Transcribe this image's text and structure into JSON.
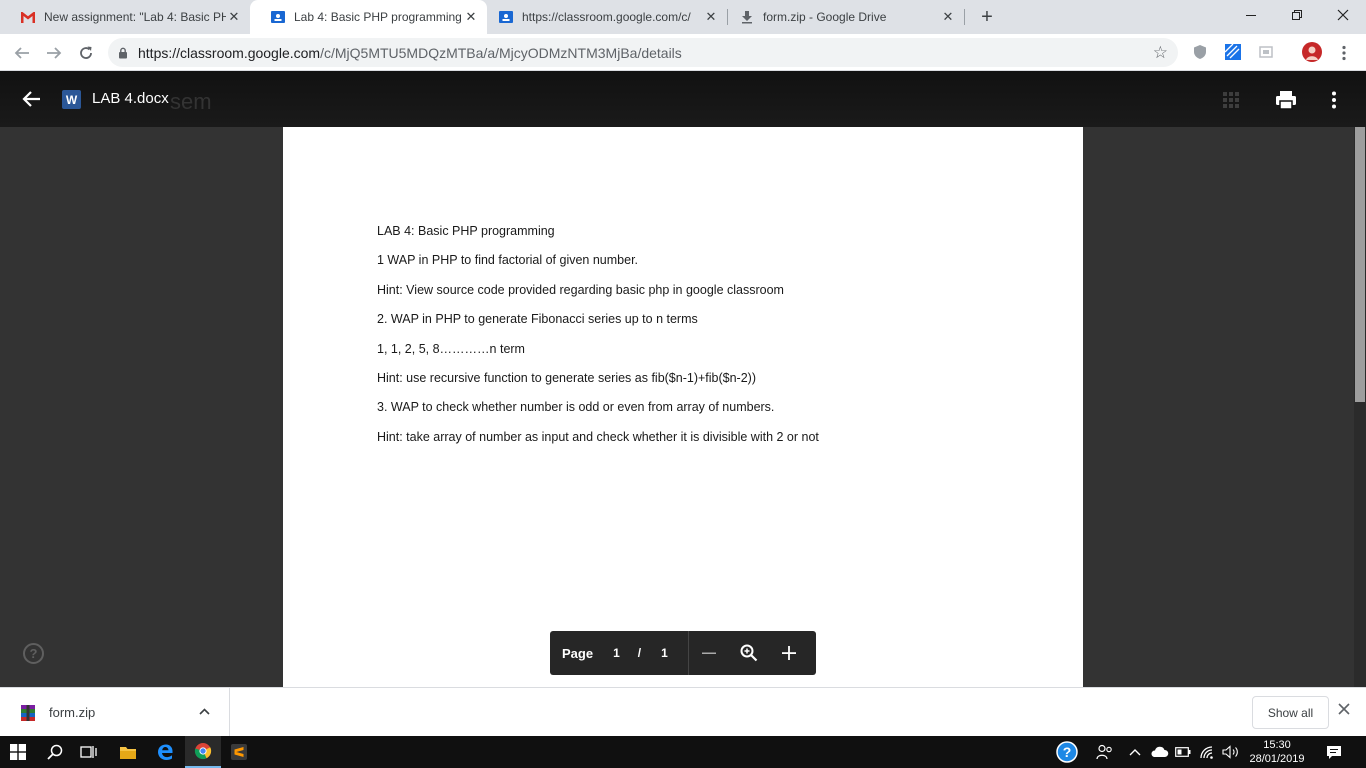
{
  "tabs": [
    {
      "title": "New assignment: \"Lab 4: Basic PH",
      "icon": "gmail-icon",
      "active": false
    },
    {
      "title": "Lab 4: Basic PHP programming",
      "icon": "classroom-icon",
      "active": true
    },
    {
      "title": "https://classroom.google.com/c/",
      "icon": "classroom-icon",
      "active": false
    },
    {
      "title": "form.zip - Google Drive",
      "icon": "drive-download-icon",
      "active": false
    }
  ],
  "address": {
    "host": "https://classroom.google.com",
    "path": "/c/MjQ5MTU5MDQzMTBa/a/MjcyODMzNTM3MjBa/details"
  },
  "viewer": {
    "app_badge": "W",
    "file_name": "LAB 4.docx",
    "ghost_text": "sem"
  },
  "document": {
    "lines": [
      "LAB 4: Basic PHP programming",
      "1 WAP in PHP to find factorial of given number.",
      "Hint: View source code provided regarding basic php in google classroom",
      "2. WAP in PHP to generate Fibonacci series up to n terms",
      "1, 1, 2, 5, 8…………n term",
      "Hint: use recursive function to generate series as fib($n-1)+fib($n-2))",
      "3. WAP to check whether number is odd or even from array of numbers.",
      "Hint: take array of number as input and check whether it is divisible with 2 or not"
    ]
  },
  "pager": {
    "label": "Page",
    "current": "1",
    "separator": "/",
    "total": "1"
  },
  "help_symbol": "?",
  "downloads": {
    "file": "form.zip",
    "show_all": "Show all"
  },
  "clock": {
    "time": "15:30",
    "date": "28/01/2019"
  },
  "colors": {
    "word_blue": "#2b5797",
    "gmail_red": "#d93025",
    "classroom_blue": "#1967d2"
  }
}
